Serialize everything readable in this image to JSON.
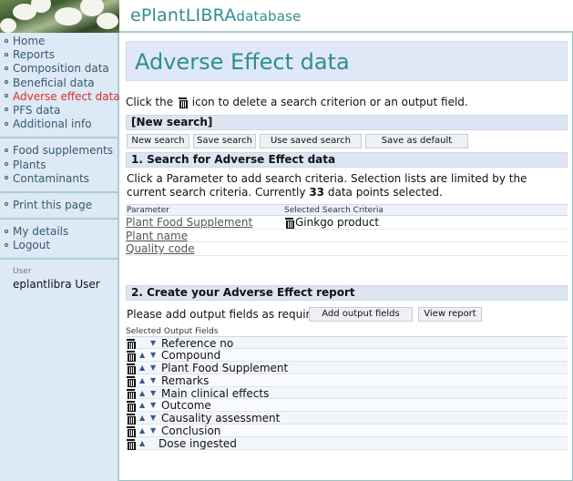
{
  "brand": {
    "prefix": "e",
    "main": "PlantLIBRA",
    "suffix": "database"
  },
  "sidebar": {
    "group1": [
      {
        "label": "Home",
        "active": false
      },
      {
        "label": "Reports",
        "active": false
      },
      {
        "label": "Composition data",
        "active": false
      },
      {
        "label": "Beneficial data",
        "active": false
      },
      {
        "label": "Adverse effect data",
        "active": true
      },
      {
        "label": "PFS data",
        "active": false
      },
      {
        "label": "Additional info",
        "active": false
      }
    ],
    "group2": [
      {
        "label": "Food supplements"
      },
      {
        "label": "Plants"
      },
      {
        "label": "Contaminants"
      }
    ],
    "group3": [
      {
        "label": "Print this page"
      }
    ],
    "group4": [
      {
        "label": "My details"
      },
      {
        "label": "Logout"
      }
    ],
    "user_label": "User",
    "user_name": "eplantlibra User"
  },
  "main": {
    "title": "Adverse Effect data",
    "instruction_before": "Click the",
    "instruction_after": "icon to delete a search criterion or an output field.",
    "new_search_label": "[New search]",
    "buttons": {
      "new_search": "New search",
      "save_search": "Save search",
      "use_saved": "Use saved search",
      "save_default": "Save as default"
    },
    "section1_title": "1. Search for Adverse Effect data",
    "section1_desc_a": "Click a Parameter to add search criteria. Selection lists are limited by the current search criteria. Currently",
    "section1_count": "33",
    "section1_desc_b": "data points selected.",
    "criteria_headers": {
      "parameter": "Parameter",
      "selected": "Selected Search Criteria"
    },
    "criteria": [
      {
        "parameter": "Plant Food Supplement",
        "value": "Ginkgo product"
      },
      {
        "parameter": "Plant name",
        "value": ""
      },
      {
        "parameter": "Quality code",
        "value": ""
      }
    ],
    "section2_title": "2. Create your Adverse Effect report",
    "report_prompt": "Please add output fields as required:",
    "add_output_btn": "Add output fields",
    "view_report_btn": "View report",
    "output_header": "Selected Output Fields",
    "output_fields": [
      {
        "label": "Reference no",
        "up": false,
        "down": true
      },
      {
        "label": "Compound",
        "up": true,
        "down": true
      },
      {
        "label": "Plant Food Supplement",
        "up": true,
        "down": true
      },
      {
        "label": "Remarks",
        "up": true,
        "down": true
      },
      {
        "label": "Main clinical effects",
        "up": true,
        "down": true
      },
      {
        "label": "Outcome",
        "up": true,
        "down": true
      },
      {
        "label": "Causality assessment",
        "up": true,
        "down": true
      },
      {
        "label": "Conclusion",
        "up": true,
        "down": true
      },
      {
        "label": "Dose ingested",
        "up": true,
        "down": false
      }
    ]
  }
}
